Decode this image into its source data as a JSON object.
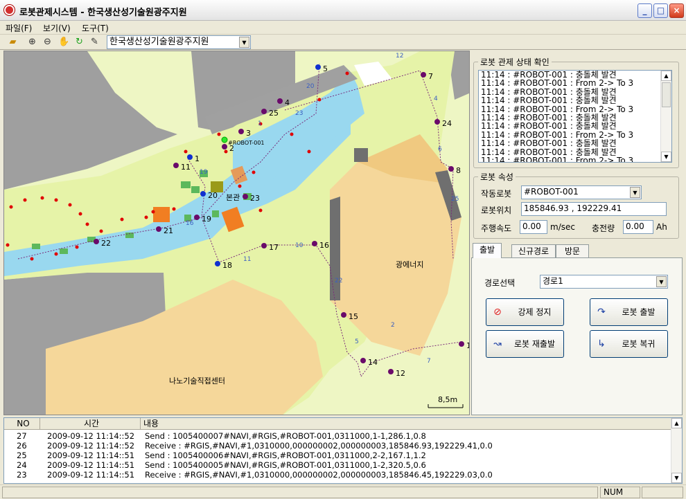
{
  "window": {
    "title": "로봇관제시스템 - 한국생산성기술원광주지원"
  },
  "menu": [
    "파일(F)",
    "보기(V)",
    "도구(T)"
  ],
  "toolbar": {
    "site_select": "한국생산성기술원광주지원"
  },
  "map": {
    "buildings": {
      "main": "본관",
      "energy": "광에너지",
      "nano": "나노기술직접센터"
    },
    "scale": "8,5m",
    "robot_label": "#ROBOT-001",
    "nodes": [
      {
        "id": "1",
        "color": "blue"
      },
      {
        "id": "2",
        "color": "purple"
      },
      {
        "id": "3",
        "color": "purple"
      },
      {
        "id": "4",
        "color": "purple"
      },
      {
        "id": "5",
        "color": "blue"
      },
      {
        "id": "7",
        "color": "purple"
      },
      {
        "id": "8",
        "color": "purple"
      },
      {
        "id": "11",
        "color": "purple"
      },
      {
        "id": "12",
        "color": "purple"
      },
      {
        "id": "13",
        "color": "purple"
      },
      {
        "id": "14",
        "color": "purple"
      },
      {
        "id": "15",
        "color": "purple"
      },
      {
        "id": "16",
        "color": "purple"
      },
      {
        "id": "17",
        "color": "purple"
      },
      {
        "id": "18",
        "color": "blue"
      },
      {
        "id": "19",
        "color": "purple"
      },
      {
        "id": "20",
        "color": "blue"
      },
      {
        "id": "21",
        "color": "purple"
      },
      {
        "id": "22",
        "color": "purple"
      },
      {
        "id": "23",
        "color": "purple"
      },
      {
        "id": "24",
        "color": "purple"
      },
      {
        "id": "25",
        "color": "purple"
      }
    ],
    "edge_labels": [
      "12",
      "20",
      "23",
      "4",
      "1",
      "19",
      "16",
      "10",
      "11",
      "22",
      "5",
      "7",
      "25",
      "2",
      "6"
    ]
  },
  "status_panel": {
    "title": "로봇 관제 상태 확인",
    "messages": [
      "11:14 : #ROBOT-001 : 충돌체 발견",
      "11:14 : #ROBOT-001 : From 2-> To 3",
      "11:14 : #ROBOT-001 : 충돌체 발견",
      "11:14 : #ROBOT-001 : 충돌체 발견",
      "11:14 : #ROBOT-001 : From 2-> To 3",
      "11:14 : #ROBOT-001 : 충돌체 발견",
      "11:14 : #ROBOT-001 : 충돌체 발견",
      "11:14 : #ROBOT-001 : From 2-> To 3",
      "11:14 : #ROBOT-001 : 충돌체 발견",
      "11:14 : #ROBOT-001 : 충돌체 발견",
      "11:14 : #ROBOT-001 : From 2-> To 3"
    ]
  },
  "robot_props": {
    "title": "로봇 속성",
    "active_label": "작동로봇",
    "active_value": "#ROBOT-001",
    "pos_label": "로봇위치",
    "pos_value": "185846.93 , 192229.41",
    "speed_label": "주행속도",
    "speed_value": "0.00",
    "speed_unit": "m/sec",
    "charge_label": "충전량",
    "charge_value": "0.00",
    "charge_unit": "Ah"
  },
  "tabs": {
    "items": [
      "출발",
      "신규경로",
      "방문"
    ],
    "route_label": "경로선택",
    "route_value": "경로1"
  },
  "buttons": {
    "force_stop": "강제 정지",
    "depart": "로봇 출발",
    "restart": "로봇 재출발",
    "return": "로봇 복귀"
  },
  "log": {
    "headers": [
      "NO",
      "시간",
      "내용"
    ],
    "rows": [
      {
        "no": "27",
        "time": "2009-09-12 11:14::52",
        "content": "Send : 1005400007#NAVI,#RGIS,#ROBOT-001,0311000,1-1,286.1,0.8"
      },
      {
        "no": "26",
        "time": "2009-09-12 11:14::52",
        "content": "Receive : #RGIS,#NAVI,#1,0310000,000000002,000000003,185846.93,192229.41,0.0"
      },
      {
        "no": "25",
        "time": "2009-09-12 11:14::51",
        "content": "Send : 1005400006#NAVI,#RGIS,#ROBOT-001,0311000,2-2,167.1,1.2"
      },
      {
        "no": "24",
        "time": "2009-09-12 11:14::51",
        "content": "Send : 1005400005#NAVI,#RGIS,#ROBOT-001,0311000,1-2,320.5,0.6"
      },
      {
        "no": "23",
        "time": "2009-09-12 11:14::51",
        "content": "Receive : #RGIS,#NAVI,#1,0310000,000000002,000000003,185846.45,192229.03,0.0"
      }
    ]
  },
  "statusbar": {
    "num": "NUM"
  }
}
